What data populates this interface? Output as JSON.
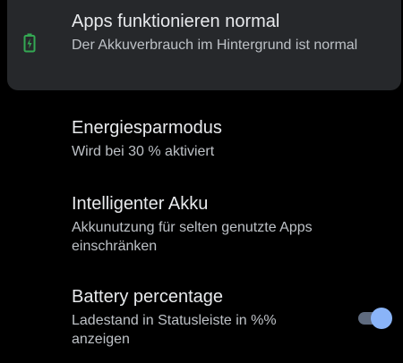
{
  "colors": {
    "background": "#000000",
    "card_background": "#26282b",
    "battery_icon": "#34a853",
    "toggle_track_on": "#5f6b7f",
    "toggle_thumb_on": "#8ab4f8"
  },
  "app_status": {
    "icon": "battery-icon",
    "title": "Apps funktionieren normal",
    "summary": "Der Akkuverbrauch im Hintergrund ist normal"
  },
  "settings": {
    "battery_saver": {
      "title": "Energiesparmodus",
      "summary": "Wird bei 30 % aktiviert"
    },
    "adaptive_battery": {
      "title": "Intelligenter Akku",
      "summary": "Akkunutzung für selten genutzte Apps einschränken"
    },
    "battery_percentage": {
      "title": "Battery percentage",
      "summary": "Ladestand in Statusleiste in %% anzeigen",
      "toggle_on": true
    }
  }
}
